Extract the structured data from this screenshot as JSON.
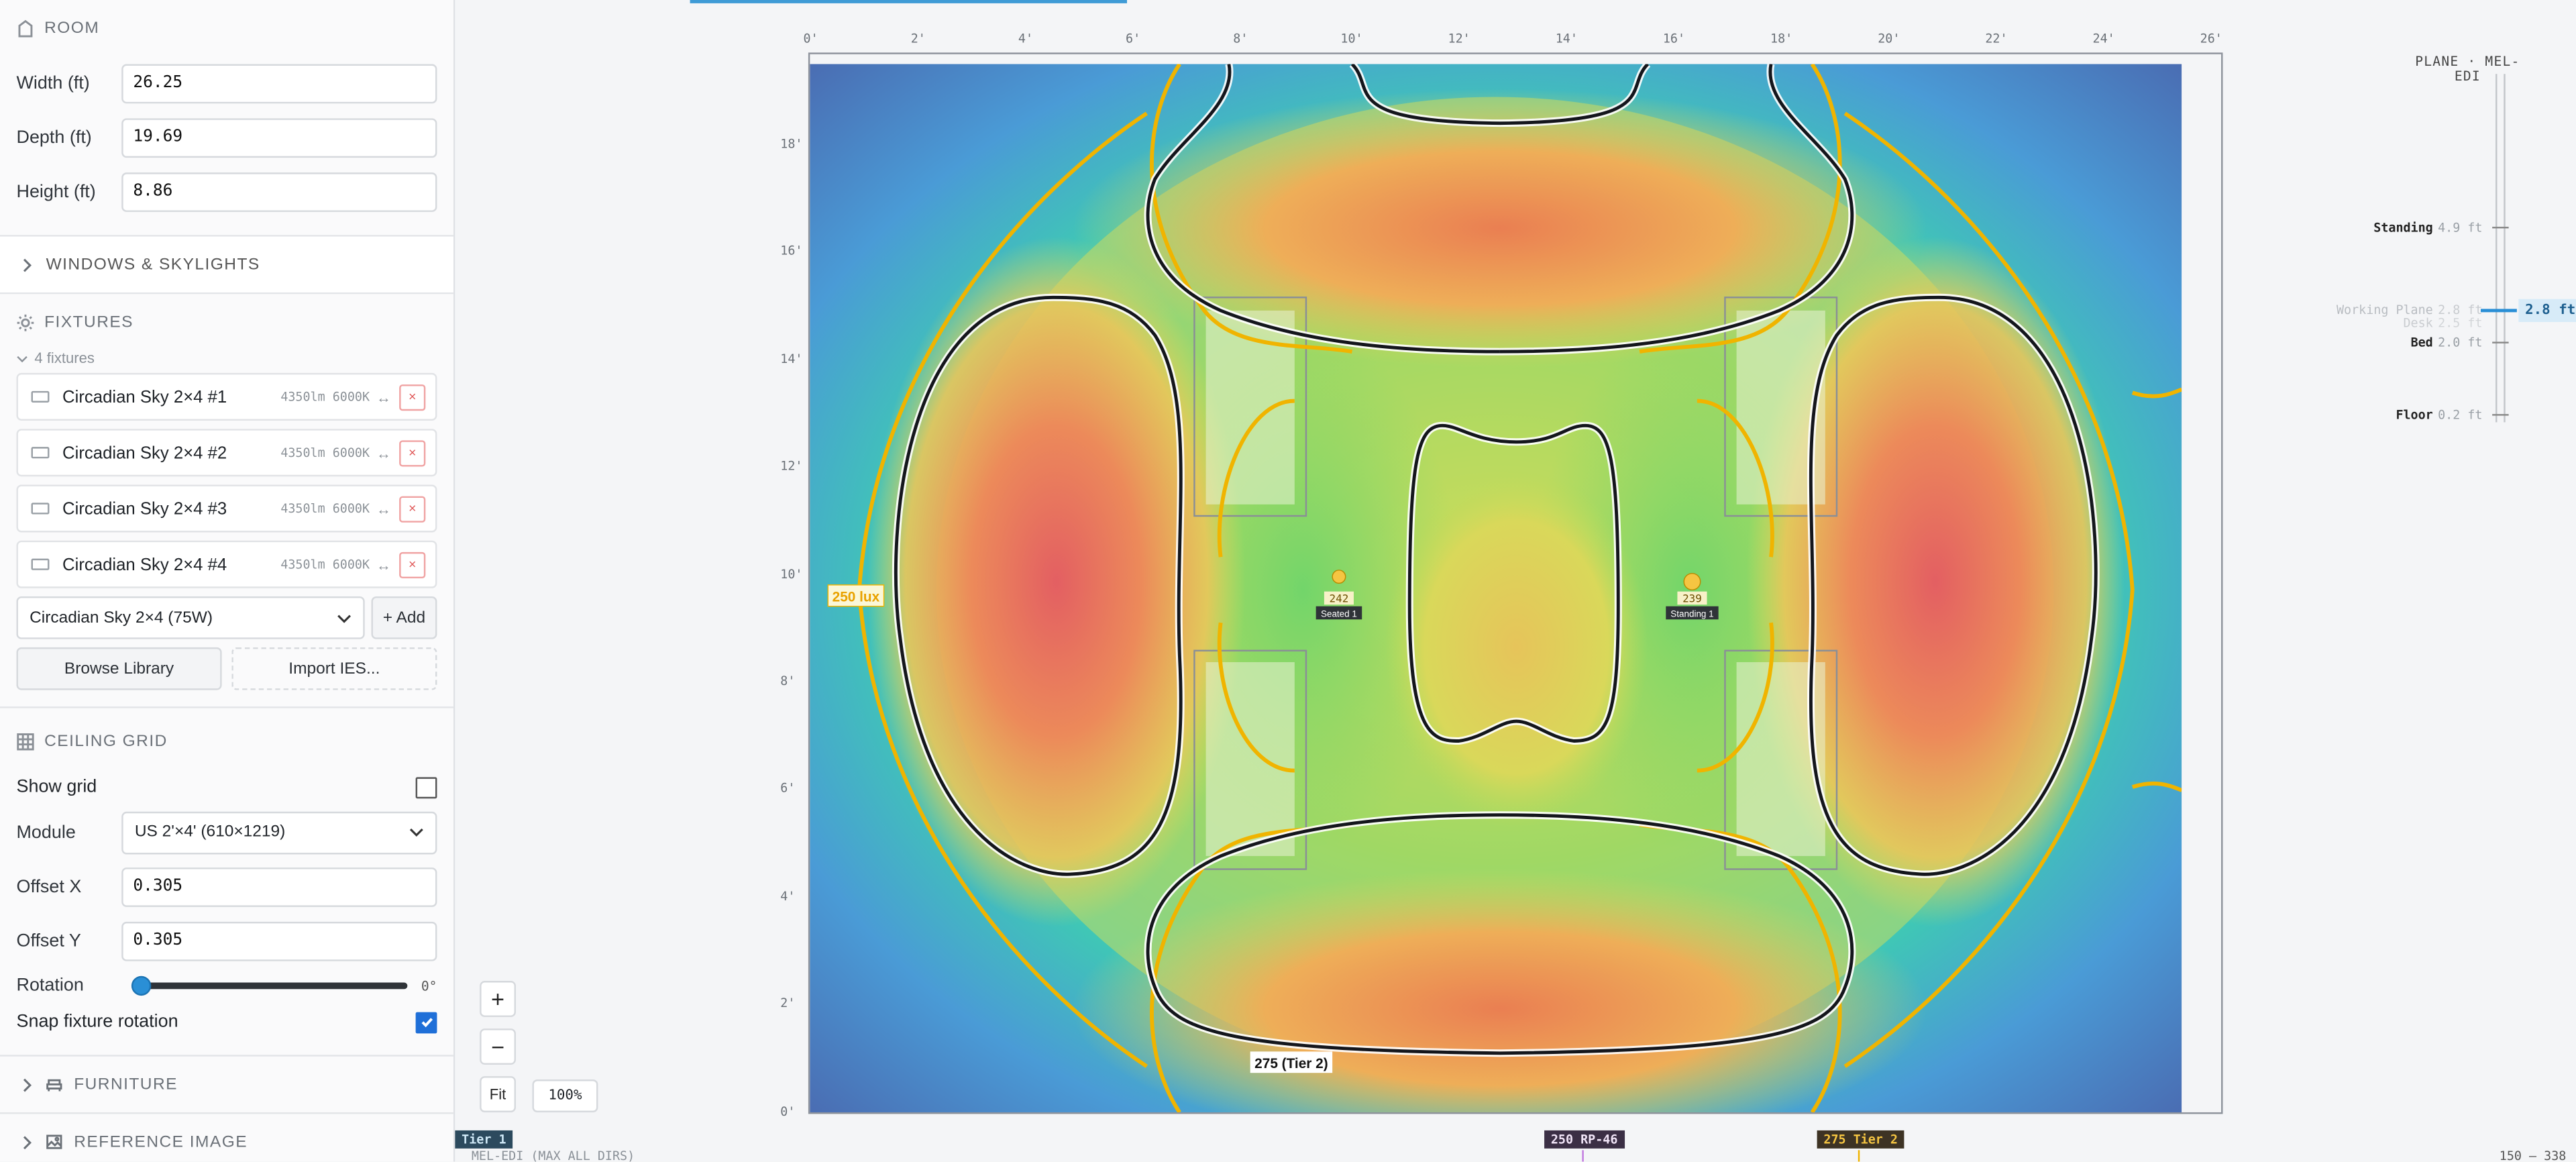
{
  "sidebar": {
    "room": {
      "title": "ROOM",
      "fields": [
        {
          "label": "Width (ft)",
          "value": "26.25"
        },
        {
          "label": "Depth (ft)",
          "value": "19.69"
        },
        {
          "label": "Height (ft)",
          "value": "8.86"
        }
      ]
    },
    "windows": {
      "title": "WINDOWS & SKYLIGHTS"
    },
    "fixtures": {
      "title": "FIXTURES",
      "count_label": "4 fixtures",
      "items": [
        {
          "name": "Circadian Sky 2×4 #1",
          "meta": "4350lm 6000K",
          "move": "↔",
          "delete": "×"
        },
        {
          "name": "Circadian Sky 2×4 #2",
          "meta": "4350lm 6000K",
          "move": "↔",
          "delete": "×"
        },
        {
          "name": "Circadian Sky 2×4 #3",
          "meta": "4350lm 6000K",
          "move": "↔",
          "delete": "×"
        },
        {
          "name": "Circadian Sky 2×4 #4",
          "meta": "4350lm 6000K",
          "move": "↔",
          "delete": "×"
        }
      ],
      "selected_model": "Circadian Sky 2×4 (75W)",
      "add_label": "+ Add",
      "browse_label": "Browse Library",
      "import_label": "Import IES..."
    },
    "ceiling_grid": {
      "title": "CEILING GRID",
      "show_grid_label": "Show grid",
      "show_grid": false,
      "module_label": "Module",
      "module_value": "US 2'×4' (610×1219)",
      "offset_x_label": "Offset X",
      "offset_x": "0.305",
      "offset_y_label": "Offset Y",
      "offset_y": "0.305",
      "rotation_label": "Rotation",
      "rotation_value": "0°",
      "rotation_fraction": 0,
      "snap_label": "Snap fixture rotation",
      "snap": true
    },
    "furniture": {
      "title": "FURNITURE"
    },
    "reference_image": {
      "title": "REFERENCE IMAGE"
    }
  },
  "canvas": {
    "x_ticks": [
      "0'",
      "2'",
      "4'",
      "6'",
      "8'",
      "10'",
      "12'",
      "14'",
      "16'",
      "18'",
      "20'",
      "22'",
      "24'",
      "26'"
    ],
    "y_ticks": [
      "18'",
      "16'",
      "14'",
      "12'",
      "10'",
      "8'",
      "6'",
      "4'",
      "2'",
      "0'"
    ],
    "contour_label_250": "250 lux",
    "contour_label_275": "275 (Tier 2)",
    "sensors": [
      {
        "value": "242",
        "label": "Seated 1"
      },
      {
        "value": "239",
        "label": "Standing 1"
      }
    ],
    "zoom_in": "+",
    "zoom_out": "−",
    "fit_label": "Fit",
    "zoom_level": "100%"
  },
  "plane": {
    "title": "PLANE · MEL-EDI",
    "levels": [
      {
        "name": "Standing",
        "value": "4.9 ft"
      },
      {
        "name": "Working Plane",
        "value": "2.8 ft"
      },
      {
        "name": "Desk",
        "value": "2.5 ft"
      },
      {
        "name": "Bed",
        "value": "2.0 ft"
      },
      {
        "name": "Floor",
        "value": "0.2 ft"
      }
    ],
    "active_value": "2.8 ft"
  },
  "bottom": {
    "tier1": "Tier 1",
    "mode_label": "MEL-EDI (MAX ALL DIRS)",
    "rp46": "250 RP-46",
    "tier2": "275 Tier 2",
    "range": "150 – 338"
  },
  "colors": {
    "accent": "#1f6fd8",
    "tier1_bg": "#2c4a5e",
    "rp46_bg": "#3b2f45",
    "tier2_bg": "#3d3324",
    "contour_250": "#f0b400",
    "contour_275": "#111111"
  }
}
